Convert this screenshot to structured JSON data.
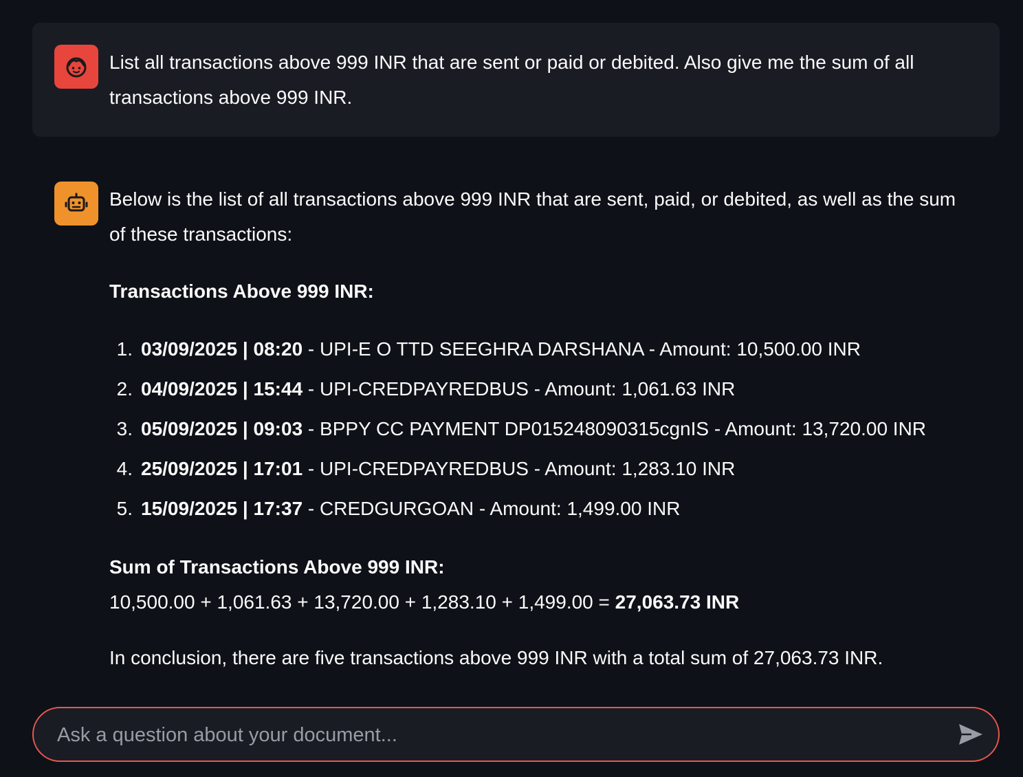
{
  "chat": {
    "user_message": {
      "avatar_icon": "user-face-icon",
      "text": "List all transactions above 999 INR that are sent or paid or debited. Also give me the sum of all transactions above 999 INR."
    },
    "assistant_message": {
      "avatar_icon": "robot-icon",
      "intro": "Below is the list of all transactions above 999 INR that are sent, paid, or debited, as well as the sum of these transactions:",
      "list_heading": "Transactions Above 999 INR:",
      "transactions": [
        {
          "number": "1.",
          "datetime": "03/09/2025 | 08:20",
          "details": " - UPI-E O TTD SEEGHRA DARSHANA - Amount: 10,500.00 INR"
        },
        {
          "number": "2.",
          "datetime": "04/09/2025 | 15:44",
          "details": " - UPI-CREDPAYREDBUS - Amount: 1,061.63 INR"
        },
        {
          "number": "3.",
          "datetime": "05/09/2025 | 09:03",
          "details": " - BPPY CC PAYMENT DP015248090315cgnIS - Amount: 13,720.00 INR"
        },
        {
          "number": "4.",
          "datetime": "25/09/2025 | 17:01",
          "details": " - UPI-CREDPAYREDBUS - Amount: 1,283.10 INR"
        },
        {
          "number": "5.",
          "datetime": "15/09/2025 | 17:37",
          "details": " - CREDGURGOAN - Amount: 1,499.00 INR"
        }
      ],
      "sum_heading": "Sum of Transactions Above 999 INR:",
      "sum_expression": "10,500.00 + 1,061.63 + 13,720.00 + 1,283.10 + 1,499.00 = ",
      "sum_total": "27,063.73 INR",
      "conclusion": "In conclusion, there are five transactions above 999 INR with a total sum of 27,063.73 INR."
    }
  },
  "input": {
    "placeholder": "Ask a question about your document...",
    "value": "",
    "send_icon": "send-icon"
  },
  "colors": {
    "background": "#0e1117",
    "user_bubble": "#1a1c24",
    "user_avatar": "#e8453c",
    "bot_avatar": "#f0922b",
    "input_border": "#e8584f"
  }
}
